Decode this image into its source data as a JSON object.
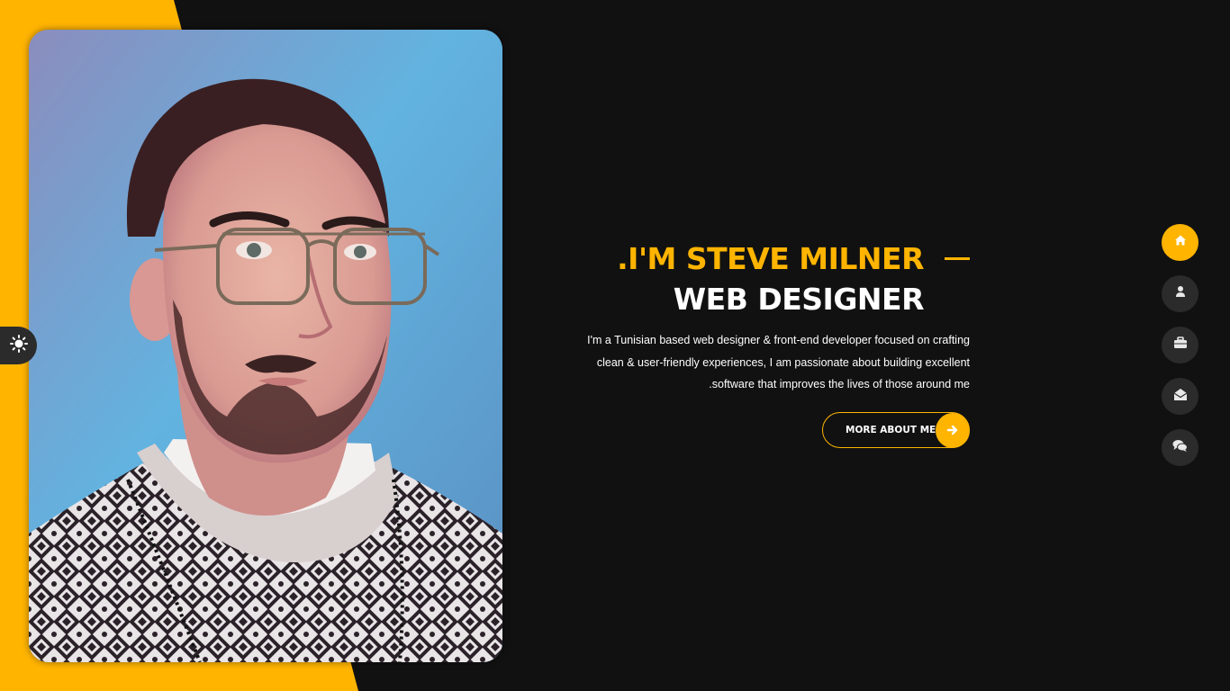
{
  "hero": {
    "name": ".I'M STEVE MILNER",
    "role": "WEB DESIGNER",
    "description_lines": [
      "I'm a Tunisian based web designer & front-end developer focused on crafting",
      "clean & user-friendly experiences, I am passionate about building excellent",
      ".software that improves the lives of those around me"
    ],
    "button_label": "MORE ABOUT ME"
  },
  "nav": {
    "items": [
      {
        "icon": "home-icon",
        "active": true
      },
      {
        "icon": "user-icon",
        "active": false
      },
      {
        "icon": "briefcase-icon",
        "active": false
      },
      {
        "icon": "envelope-open-icon",
        "active": false
      },
      {
        "icon": "comments-icon",
        "active": false
      }
    ]
  },
  "theme_toggle": {
    "icon": "sun-icon"
  },
  "colors": {
    "accent": "#ffb400",
    "background": "#111111",
    "nav_inactive": "#2b2b2b",
    "text": "#ffffff"
  }
}
